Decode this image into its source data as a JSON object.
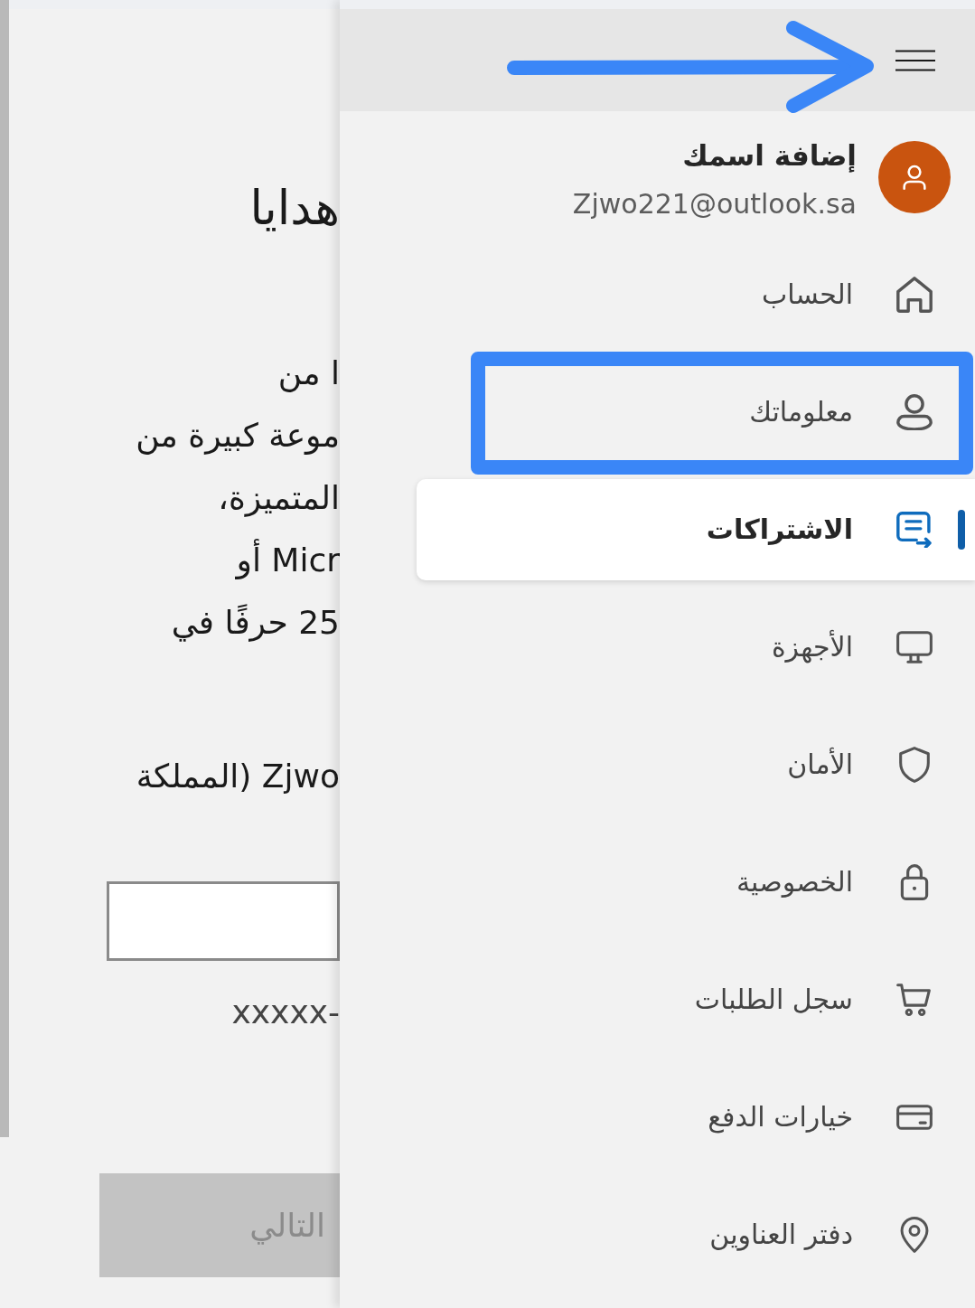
{
  "page": {
    "title": "هدايا",
    "paragraph_lines": [
      "ا من",
      "موعة كبيرة من",
      "المتميزة،",
      "Micr أو",
      "25 حرفًا في"
    ],
    "account_line": "Zjwo (المملكة",
    "code_format": "xxxxx-",
    "next_button": {
      "label": "التالي",
      "disabled": true
    }
  },
  "drawer": {
    "profile": {
      "name": "إضافة اسمك",
      "email": "Zjwo221@outlook.sa"
    },
    "menu_items": [
      {
        "label": "الحساب",
        "selected": false,
        "highlighted": false
      },
      {
        "label": "معلوماتك",
        "selected": false,
        "highlighted": true
      },
      {
        "label": "الاشتراكات",
        "selected": true,
        "highlighted": false
      },
      {
        "label": "الأجهزة",
        "selected": false,
        "highlighted": false
      },
      {
        "label": "الأمان",
        "selected": false,
        "highlighted": false
      },
      {
        "label": "الخصوصية",
        "selected": false,
        "highlighted": false
      },
      {
        "label": "سجل الطلبات",
        "selected": false,
        "highlighted": false
      },
      {
        "label": "خيارات الدفع",
        "selected": false,
        "highlighted": false
      },
      {
        "label": "دفتر العناوين",
        "selected": false,
        "highlighted": false
      }
    ]
  }
}
